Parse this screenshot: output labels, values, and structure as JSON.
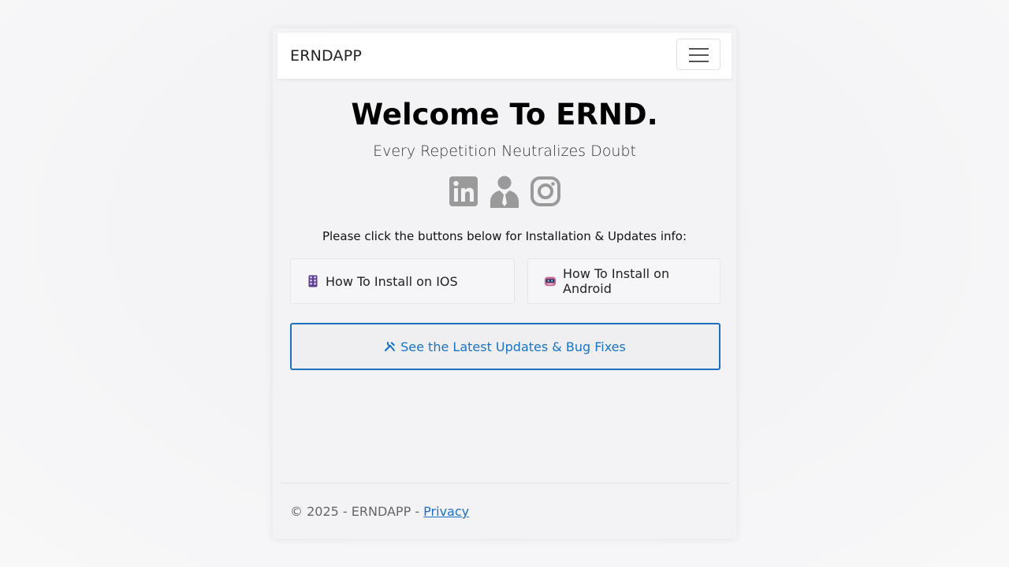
{
  "navbar": {
    "brand": "ERNDAPP",
    "menu_icon": "hamburger-menu-icon"
  },
  "hero": {
    "heading": "Welcome To ERND.",
    "tagline": "Every Repetition Neutralizes Doubt"
  },
  "socials": [
    {
      "icon": "linkedin-icon"
    },
    {
      "icon": "person-icon"
    },
    {
      "icon": "instagram-icon"
    }
  ],
  "instruction": "Please click the buttons below for Installation & Updates info:",
  "buttons": {
    "ios_label": "How To Install on IOS",
    "ios_icon": "phone-icon",
    "android_label": "How To Install on Android",
    "android_icon": "robot-icon",
    "updates_label": "See the Latest Updates & Bug Fixes",
    "updates_icon": "tools-icon"
  },
  "footer": {
    "copyright": "© 2025 - ERNDAPP - ",
    "privacy_link": "Privacy"
  },
  "colors": {
    "accent": "#1f6fc1",
    "social_icon": "#9a9a9a"
  }
}
